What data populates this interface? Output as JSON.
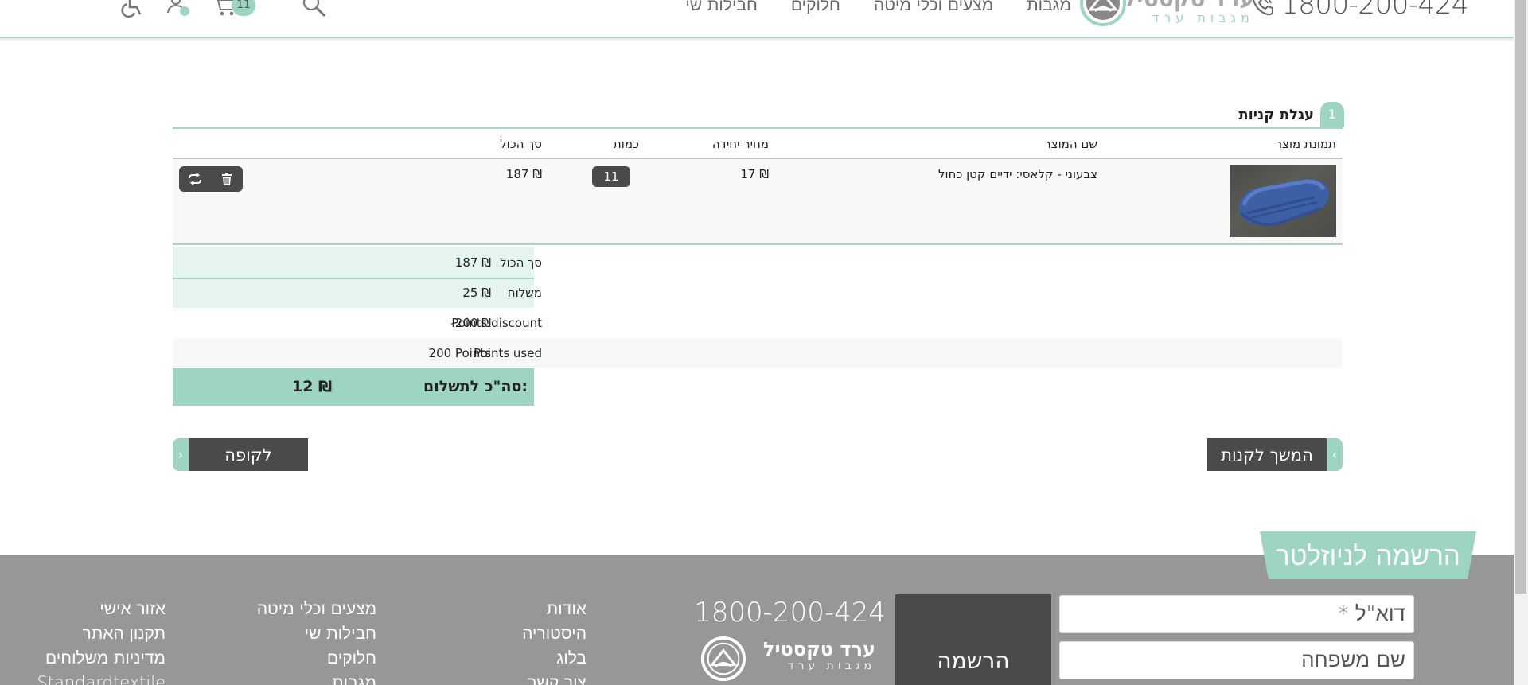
{
  "header": {
    "phone": "1800-200-424",
    "logo_main": "ערד טקסטיל",
    "logo_sub": "מגבות ערד",
    "nav": [
      "מגבות",
      "מצעים וכלי מיטה",
      "חלוקים",
      "חבילות שי"
    ],
    "cart_count": "11"
  },
  "cart": {
    "step": "1",
    "title": "עגלת קניות",
    "columns": {
      "image": "תמונת מוצר",
      "name": "שם המוצר",
      "unit_price": "מחיר יחידה",
      "quantity": "כמות",
      "total": "סך הכול"
    },
    "items": [
      {
        "name": "צבעוני - קלאסי: ידיים קטן כחול",
        "unit_price": "17 ₪",
        "quantity": "11",
        "total": "187 ₪"
      }
    ],
    "summary": {
      "subtotal_label": "סך הכול",
      "subtotal_value": "187 ₪",
      "shipping_label": "משלוח",
      "shipping_value": "25 ₪",
      "points_discount_label": "Points discount",
      "points_discount_value": "-200 ₪",
      "points_used_label": "Points used",
      "points_used_value": "200 Points",
      "grand_total_label": "סה\"כ לתשלום:",
      "grand_total_value": "12 ₪"
    },
    "checkout_label": "לקופה",
    "continue_label": "המשך לקנות"
  },
  "footer": {
    "newsletter_title": "הרשמה לניוזלטר",
    "email_placeholder": "דוא\"ל *",
    "lastname_placeholder": "שם משפחה",
    "submit_label": "הרשמה",
    "phone": "1800-200-424",
    "logo_main": "ערד טקסטיל",
    "logo_sub": "מגבות ערד",
    "col1": [
      "אודות",
      "היסטוריה",
      "בלוג",
      "צור קשר"
    ],
    "col2": [
      "מצעים וכלי מיטה",
      "חבילות שי",
      "חלוקים",
      "מגבות"
    ],
    "col3": [
      "אזור אישי",
      "תקנון האתר",
      "מדיניות משלוחים",
      "Standardtextile"
    ]
  },
  "colors": {
    "accent": "#9ed5c0",
    "dark_button": "#4a4a4a",
    "footer_bg": "#979799"
  }
}
